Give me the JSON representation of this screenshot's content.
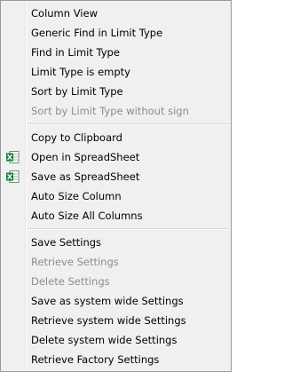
{
  "menu": {
    "group1": [
      {
        "label": "Column View",
        "disabled": false
      },
      {
        "label": "Generic Find in Limit Type",
        "disabled": false
      },
      {
        "label": "Find in Limit Type",
        "disabled": false
      },
      {
        "label": "Limit Type is empty",
        "disabled": false
      },
      {
        "label": "Sort by Limit Type",
        "disabled": false
      },
      {
        "label": "Sort by Limit Type without sign",
        "disabled": true
      }
    ],
    "group2": [
      {
        "label": "Copy to Clipboard",
        "disabled": false
      },
      {
        "label": "Open in SpreadSheet",
        "disabled": false,
        "icon": "excel-icon"
      },
      {
        "label": "Save as SpreadSheet",
        "disabled": false,
        "icon": "excel-icon"
      },
      {
        "label": "Auto Size Column",
        "disabled": false
      },
      {
        "label": "Auto Size All Columns",
        "disabled": false
      }
    ],
    "group3": [
      {
        "label": "Save Settings",
        "disabled": false
      },
      {
        "label": "Retrieve Settings",
        "disabled": true
      },
      {
        "label": "Delete Settings",
        "disabled": true
      },
      {
        "label": "Save as system wide Settings",
        "disabled": false
      },
      {
        "label": "Retrieve system wide Settings",
        "disabled": false
      },
      {
        "label": "Delete system wide Settings",
        "disabled": false
      },
      {
        "label": "Retrieve Factory Settings",
        "disabled": false
      }
    ]
  },
  "colors": {
    "menu_bg": "#f0f0f0",
    "text": "#000000",
    "disabled_text": "#8c8c8c",
    "excel_green": "#1d7a3a"
  }
}
